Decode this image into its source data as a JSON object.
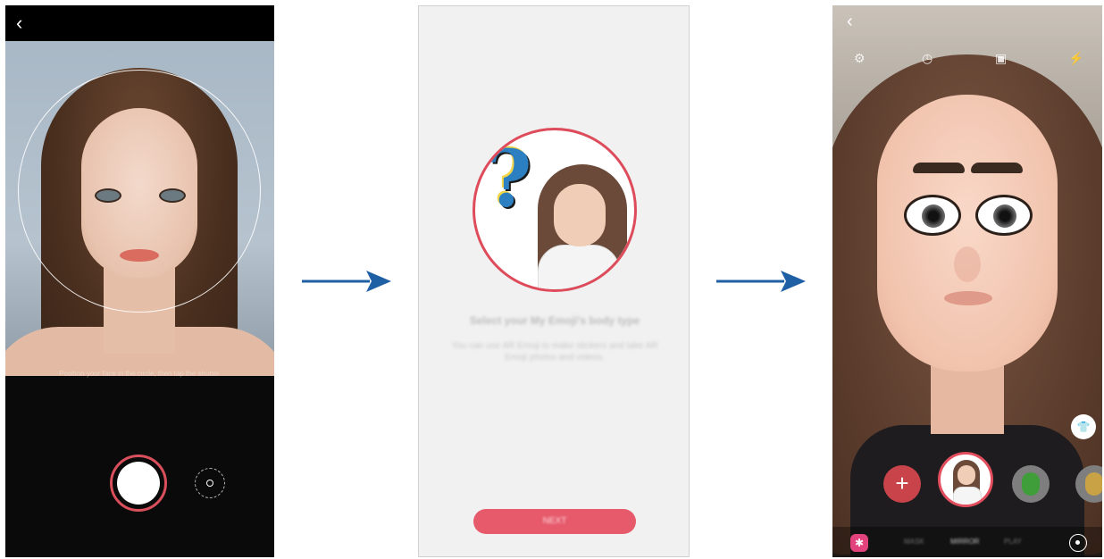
{
  "screen1": {
    "back_icon": "chevron-left-icon",
    "back_glyph": "‹",
    "hint": "Position your face in the circle, then tap the shutter",
    "shutter_icon": "shutter-button",
    "switch_icon": "switch-camera-icon"
  },
  "arrows": {
    "color": "#1f5fa3"
  },
  "screen2": {
    "title": "Select your My Emoji's body type",
    "description": "You can use AR Emoji to make stickers and take AR Emoji photos and videos.",
    "button_label": "NEXT"
  },
  "screen3": {
    "back_glyph": "‹",
    "top_icons": [
      {
        "name": "settings-icon",
        "glyph": "⚙"
      },
      {
        "name": "timer-off-icon",
        "glyph": "◷"
      },
      {
        "name": "aspect-ratio-icon",
        "glyph": "▣"
      },
      {
        "name": "flash-icon",
        "glyph": "⚡"
      }
    ],
    "plus_label": "+",
    "shirt_glyph": "👕",
    "sticker_glyph": "✱",
    "modes": [
      "MASK",
      "MIRROR",
      "PLAY"
    ],
    "accent": "#e24e5e"
  }
}
